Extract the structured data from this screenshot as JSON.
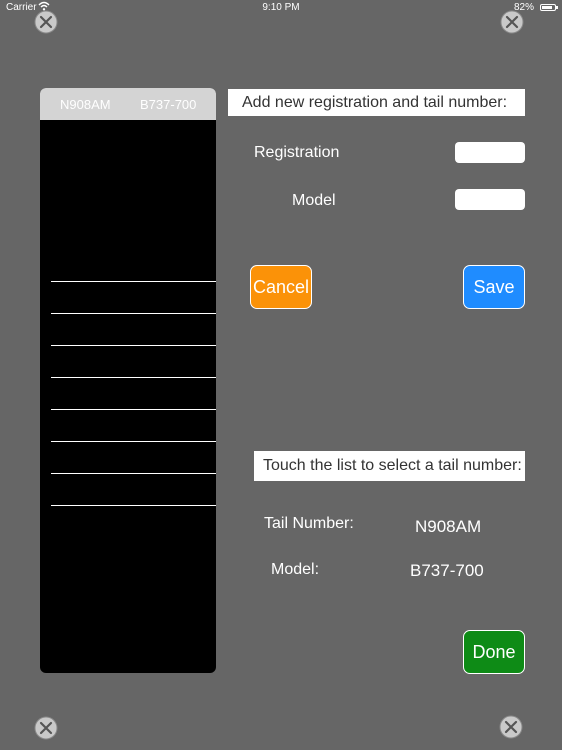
{
  "status_bar": {
    "carrier": "Carrier",
    "time": "9:10 PM",
    "battery": "82%",
    "battery_level": 0.82
  },
  "list": {
    "header": {
      "registration": "N908AM",
      "model": "B737-700"
    },
    "visible_rows": 8
  },
  "add_section": {
    "title": "Add new registration and tail number:",
    "registration_label": "Registration",
    "registration_value": "",
    "model_label": "Model",
    "model_value": "",
    "cancel_label": "Cancel",
    "save_label": "Save"
  },
  "select_section": {
    "title": "Touch the list to select a tail number:",
    "tail_number_label": "Tail Number:",
    "tail_number_value": "N908AM",
    "model_label": "Model:",
    "model_value": "B737-700",
    "done_label": "Done"
  },
  "colors": {
    "background": "#666666",
    "cancel": "#fb9208",
    "save": "#1f8cff",
    "done": "#0e8b16"
  },
  "icons": [
    "screw-icon",
    "wifi-icon",
    "battery-icon"
  ]
}
